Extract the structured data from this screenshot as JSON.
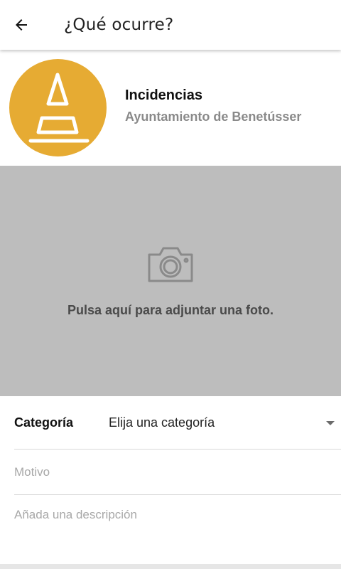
{
  "appbar": {
    "title": "¿Qué ocurre?",
    "back_icon": "arrow-left-icon"
  },
  "header": {
    "title": "Incidencias",
    "subtitle": "Ayuntamiento de Benetússer",
    "logo_color": "#E6AB33",
    "logo_icon": "traffic-cone-icon"
  },
  "photo": {
    "hint": "Pulsa aquí para adjuntar una foto.",
    "icon": "camera-icon",
    "background": "#bdbdbd"
  },
  "form": {
    "category_label": "Categoría",
    "category_value": "Elija una categoría",
    "motivo_placeholder": "Motivo",
    "description_placeholder": "Añada una descripción"
  }
}
